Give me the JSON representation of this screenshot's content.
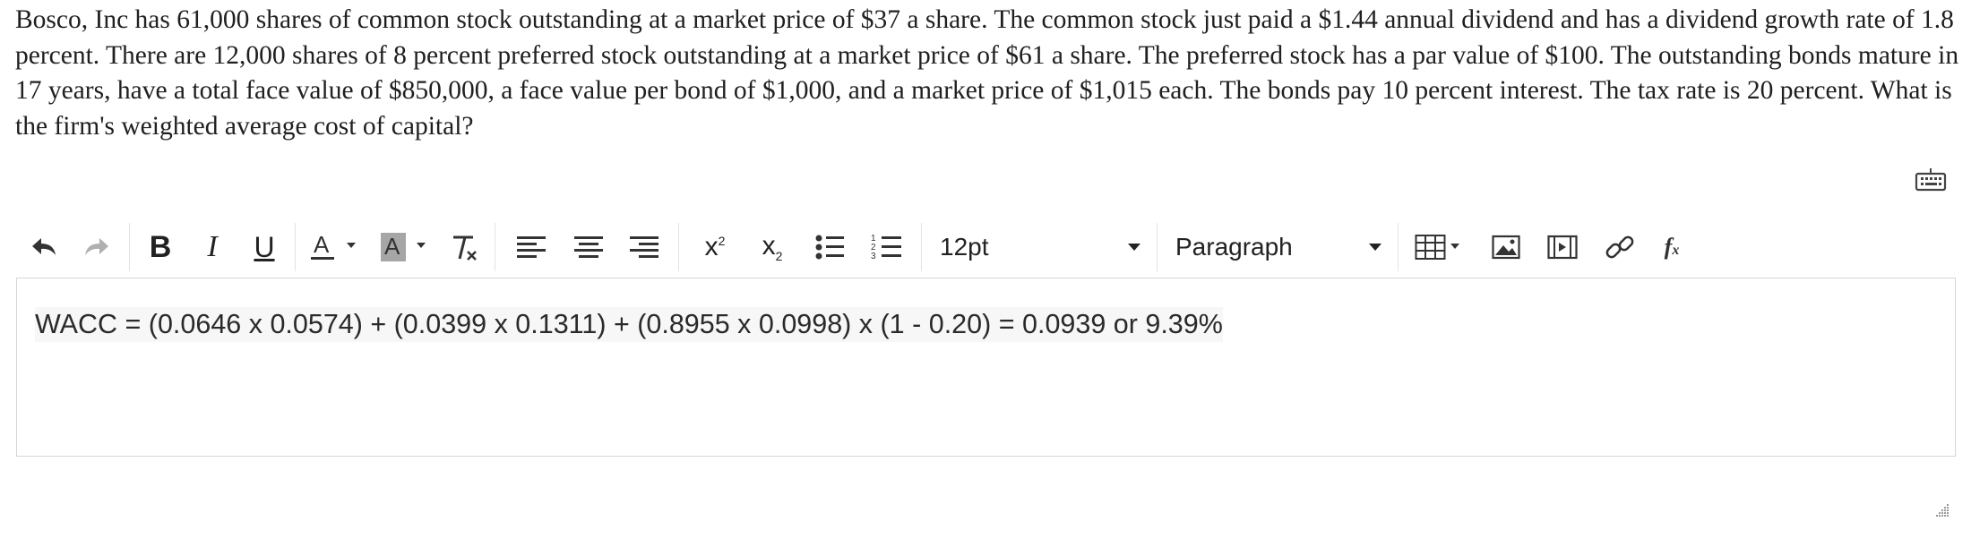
{
  "question": {
    "text": "Bosco, Inc has 61,000 shares of common stock outstanding at a market price of $37 a share. The common stock just paid a $1.44 annual dividend and has a dividend growth rate of 1.8 percent. There are 12,000 shares of 8 percent preferred stock outstanding at a market price of $61 a share. The preferred stock has a par value of $100. The outstanding bonds mature in 17 years, have a total face value of $850,000, a face value per bond of $1,000, and a market price of $1,015 each. The bonds pay 10 percent interest. The tax rate is 20 percent. What is the firm's weighted average cost of capital?"
  },
  "toolbar": {
    "font_size": "12pt",
    "block_format": "Paragraph",
    "icons": [
      "undo-icon",
      "redo-icon",
      "bold-icon",
      "italic-icon",
      "underline-icon",
      "text-color-icon",
      "background-color-icon",
      "clear-formatting-icon",
      "align-left-icon",
      "align-center-icon",
      "align-right-icon",
      "superscript-icon",
      "subscript-icon",
      "bullet-list-icon",
      "numbered-list-icon",
      "table-icon",
      "image-icon",
      "media-icon",
      "link-icon",
      "formula-icon",
      "keyboard-icon"
    ]
  },
  "editor": {
    "content": "WACC = (0.0646 x 0.0574) + (0.0399 x 0.1311) + (0.8955 x 0.0998) x (1 - 0.20) = 0.0939 or 9.39%"
  },
  "colors": {
    "text": "#202020",
    "border": "#d6d6d6",
    "separator": "#e3e3e3",
    "highlight": "#a6a6a6"
  }
}
